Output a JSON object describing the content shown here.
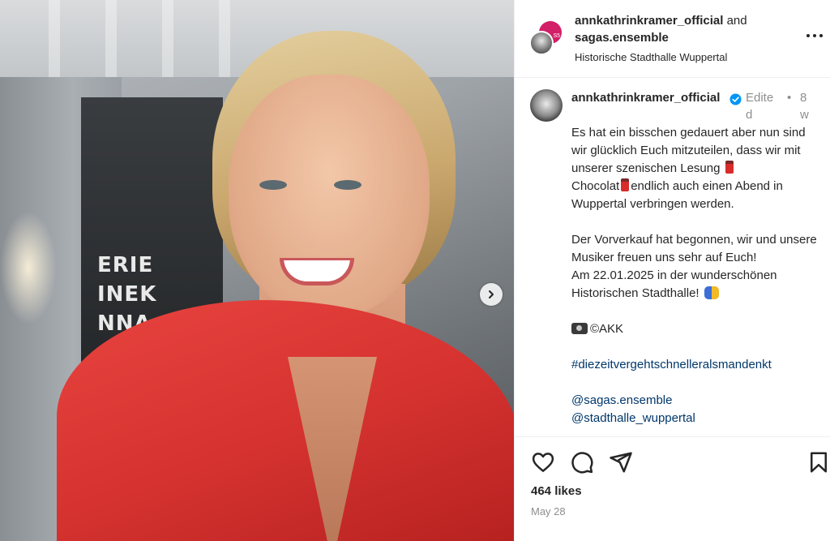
{
  "post": {
    "header": {
      "author_primary": "annkathrinkramer_official",
      "joiner": " and",
      "author_secondary": "sagas.ensemble",
      "location": "Historische Stadthalle Wuppertal",
      "avatar_badge": "S5"
    },
    "photo": {
      "sign_lines": [
        "ERIE",
        "INEK",
        "NNA"
      ]
    },
    "caption": {
      "username": "annkathrinkramer_official",
      "edited_label": "Edited",
      "separator": "•",
      "age": "8w",
      "line1a": "Es hat ein bisschen gedauert aber nun sind wir glücklich Euch mitzuteilen, dass wir mit unserer szenischen Lesung",
      "line1b": "Chocolat",
      "line1c": "endlich auch einen Abend in Wuppertal verbringen werden.",
      "para2": "Der Vorverkauf hat begonnen, wir und unsere Musiker freuen uns sehr auf Euch!",
      "para3": "Am 22.01.2025 in der wunderschönen Historischen Stadthalle!",
      "credit": "©AKK",
      "hashtag": "#diezeitvergehtschnelleralsmandenkt",
      "mention1": "@sagas.ensemble",
      "mention2": "@stadthalle_wuppertal"
    },
    "likes": "464 likes",
    "date": "May 28"
  },
  "icons": {
    "like": "heart-icon",
    "comment": "comment-icon",
    "share": "share-icon",
    "save": "bookmark-icon",
    "more": "more-options-icon",
    "next": "chevron-right-icon",
    "verified": "verified-badge-icon"
  },
  "colors": {
    "link": "#00376b",
    "verified": "#0095f6",
    "muted": "#8e8e8e",
    "blouse_red": "#d63330"
  }
}
